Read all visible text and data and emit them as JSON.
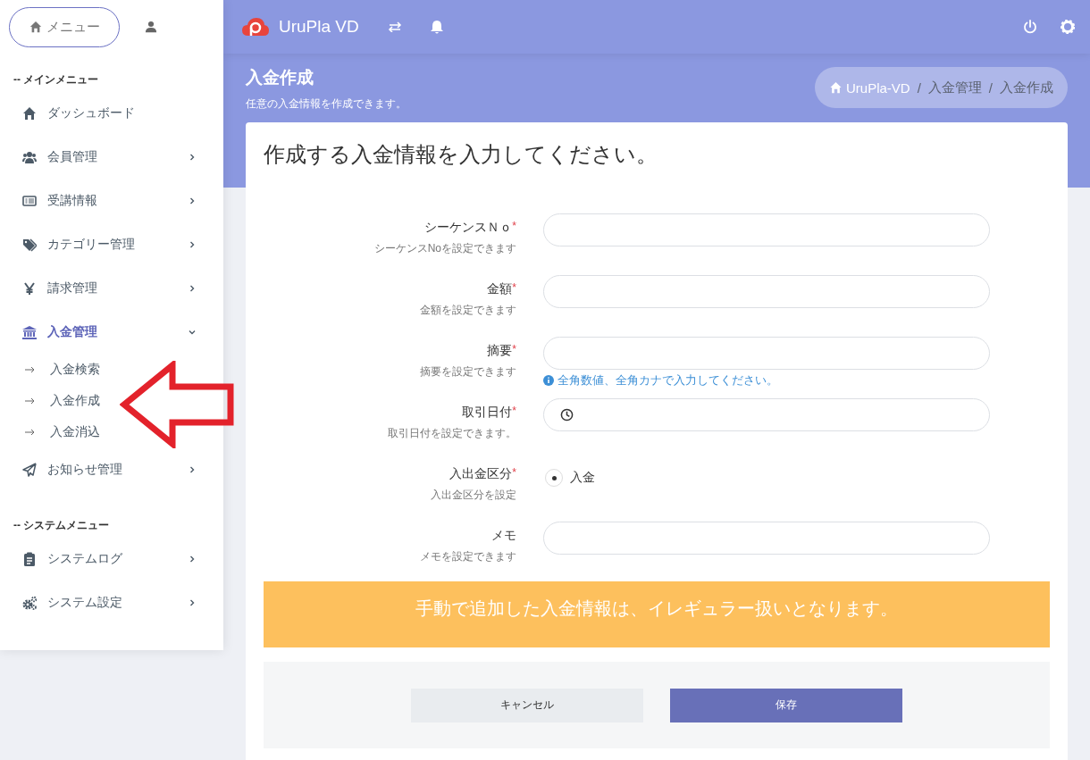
{
  "sidebar": {
    "menu_button": "メニュー",
    "sections": [
      {
        "heading": "-- メインメニュー",
        "items": [
          {
            "label": "ダッシュボード",
            "selected": false
          },
          {
            "label": "会員管理",
            "expanded": false,
            "selected": false
          },
          {
            "label": "受講情報",
            "expanded": false,
            "selected": false
          },
          {
            "label": "カテゴリー管理",
            "expanded": false,
            "selected": false
          },
          {
            "label": "請求管理",
            "expanded": false,
            "selected": false
          },
          {
            "label": "入金管理",
            "expanded": true,
            "selected": true,
            "children": [
              {
                "label": "入金検索",
                "selected": false
              },
              {
                "label": "入金作成",
                "selected": false
              },
              {
                "label": "入金消込",
                "selected": false
              }
            ]
          },
          {
            "label": "お知らせ管理",
            "expanded": false,
            "selected": false
          }
        ]
      },
      {
        "heading": "-- システムメニュー",
        "items": [
          {
            "label": "システムログ",
            "expanded": false,
            "selected": false
          },
          {
            "label": "システム設定",
            "expanded": false,
            "selected": false
          }
        ]
      }
    ]
  },
  "topbar": {
    "brand": "UruPla VD"
  },
  "page_header": {
    "title": "入金作成",
    "subtitle": "任意の入金情報を作成できます。",
    "breadcrumb": {
      "separator": "/",
      "items": [
        "UruPla-VD",
        "入金管理",
        "入金作成"
      ]
    }
  },
  "form": {
    "heading": "作成する入金情報を入力してください。",
    "fields": [
      {
        "kind": "text",
        "label": "シーケンスＮｏ",
        "required_mark": "*",
        "help": "シーケンスNoを設定できます"
      },
      {
        "kind": "text",
        "label": "金額",
        "required_mark": "*",
        "help": "金額を設定できます"
      },
      {
        "kind": "text",
        "label": "摘要",
        "required_mark": "*",
        "help": "摘要を設定できます",
        "hint": "全角数値、全角カナで入力してください。"
      },
      {
        "kind": "date",
        "label": "取引日付",
        "required_mark": "*",
        "help": "取引日付を設定できます。"
      },
      {
        "kind": "radio",
        "label": "入出金区分",
        "required_mark": "*",
        "help": "入出金区分を設定",
        "options": [
          {
            "label": "入金",
            "selected": true
          }
        ]
      },
      {
        "kind": "text",
        "label": "メモ",
        "help": "メモを設定できます"
      }
    ],
    "notice": "手動で追加した入金情報は、イレギュラー扱いとなります。",
    "buttons": [
      {
        "kind": "secondary",
        "label": "キャンセル"
      },
      {
        "kind": "primary",
        "label": "保存"
      }
    ]
  }
}
